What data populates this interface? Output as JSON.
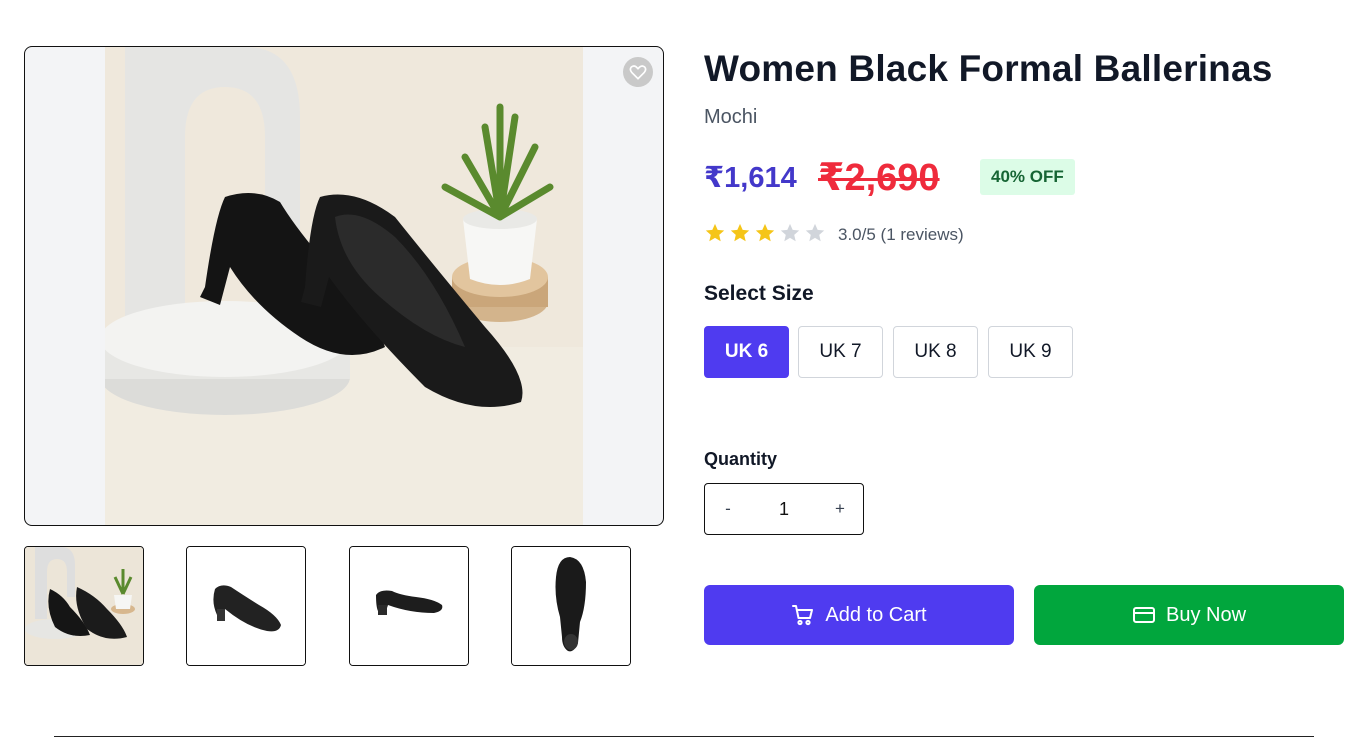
{
  "product": {
    "title": "Women Black Formal Ballerinas",
    "brand": "Mochi",
    "price": "₹1,614",
    "mrp": "₹2,690",
    "discount": "40% OFF",
    "rating": {
      "value": 3.0,
      "max": 5,
      "filled_stars": 3,
      "text": "3.0/5 (1 reviews)"
    }
  },
  "gallery": {
    "wishlist_icon": "heart-icon",
    "thumbnails": [
      "thumbnail-pair-lifestyle",
      "thumbnail-side-view",
      "thumbnail-profile-view",
      "thumbnail-sole-view"
    ]
  },
  "size_selector": {
    "label": "Select Size",
    "options": [
      "UK 6",
      "UK 7",
      "UK 8",
      "UK 9"
    ],
    "selected": "UK 6"
  },
  "quantity": {
    "label": "Quantity",
    "decrement": "-",
    "value": "1",
    "increment": "+"
  },
  "actions": {
    "add_to_cart": {
      "label": "Add to Cart",
      "icon": "cart-icon"
    },
    "buy_now": {
      "label": "Buy Now",
      "icon": "credit-card-icon"
    }
  },
  "colors": {
    "primary": "#4f3bf0",
    "buy": "#01a63d",
    "price": "#4338ca",
    "mrp": "#ef2b3c",
    "discount_bg": "#dcfce7",
    "discount_text": "#166534",
    "star_filled": "#f5c518",
    "star_empty": "#d1d5db"
  }
}
